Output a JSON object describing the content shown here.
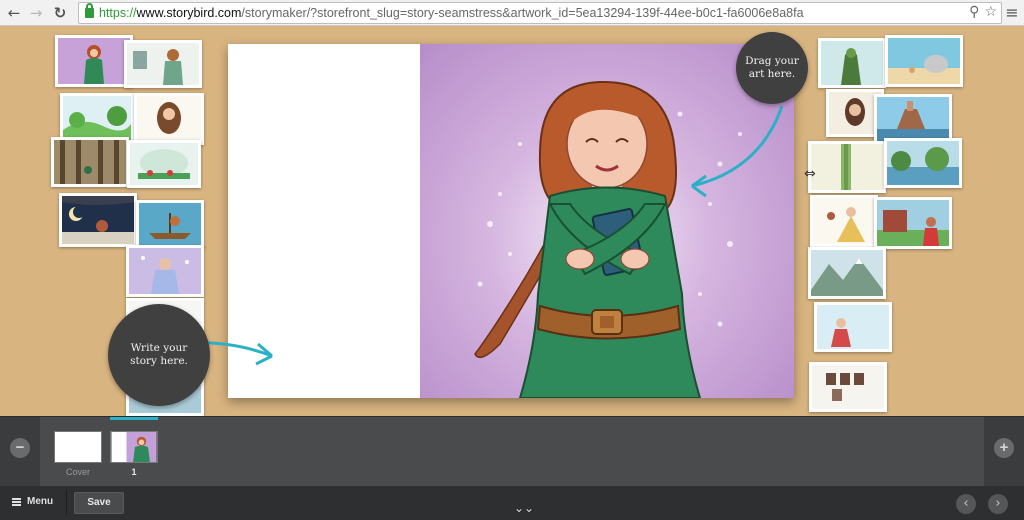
{
  "browser": {
    "url_scheme": "https://",
    "url_host": "www.storybird.com",
    "url_path": "/storymaker/?storefront_slug=story-seamstress&artwork_id=5ea13294-139f-44ee-b0c1-fa6006e8a8fa",
    "back_glyph": "←",
    "forward_glyph": "→",
    "reload_glyph": "↻",
    "zoom_glyph": "⚲",
    "star_glyph": "☆",
    "menu_glyph": "≡"
  },
  "icons": {
    "back": "back-arrow-icon",
    "forward": "forward-arrow-icon",
    "reload": "reload-icon",
    "lock": "lock-icon",
    "zoom": "zoom-icon",
    "star": "bookmark-star-icon",
    "browser_menu": "hamburger-icon",
    "filmstrip_left": "minus-circle-icon",
    "filmstrip_right": "plus-circle-icon",
    "menu": "hamburger-icon",
    "collapse": "double-chevron-down-icon",
    "prev": "chevron-left-icon",
    "next": "chevron-right-icon"
  },
  "hints": {
    "drag_art": "Drag your art here.",
    "write_story": "Write your story here."
  },
  "filmstrip": {
    "left_glyph": "−",
    "right_glyph": "+",
    "pages": [
      {
        "label": "Cover",
        "active": false
      },
      {
        "label": "1",
        "active": true
      }
    ]
  },
  "toolbar": {
    "menu_label": "Menu",
    "save_label": "Save",
    "collapse_glyph": "⌄⌄",
    "prev_glyph": "‹",
    "next_glyph": "›"
  },
  "cursor_glyph": "⇔",
  "colors": {
    "desk": "#d8b480",
    "accent": "#2cb0c7",
    "bubble": "#404041",
    "toolbar": "#2e2f31",
    "url_secure": "#2f9a3a"
  }
}
